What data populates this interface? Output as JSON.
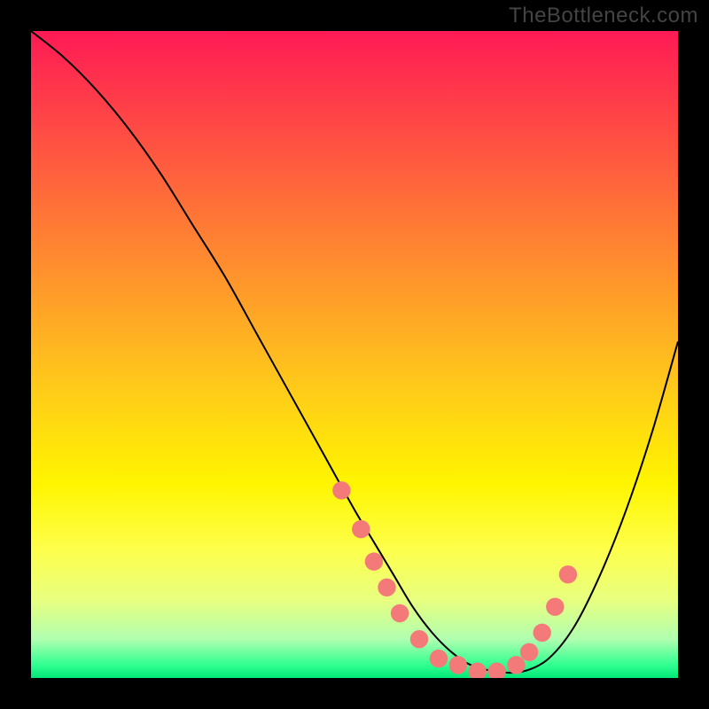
{
  "watermark": "TheBottleneck.com",
  "chart_data": {
    "type": "line",
    "title": "",
    "xlabel": "",
    "ylabel": "",
    "xlim": [
      0,
      100
    ],
    "ylim": [
      0,
      100
    ],
    "series": [
      {
        "name": "curve",
        "x": [
          0,
          5,
          10,
          15,
          20,
          25,
          30,
          35,
          40,
          45,
          50,
          53,
          56,
          59,
          62,
          65,
          68,
          72,
          76,
          80,
          84,
          88,
          92,
          96,
          100
        ],
        "values": [
          100,
          96,
          91,
          85,
          78,
          70,
          62,
          53,
          44,
          35,
          26,
          21,
          16,
          11,
          7,
          4,
          2,
          1,
          1,
          3,
          8,
          16,
          26,
          38,
          52
        ]
      }
    ],
    "markers": {
      "name": "highlight-points",
      "color": "#f47a7a",
      "x": [
        48,
        51,
        53,
        55,
        57,
        60,
        63,
        66,
        69,
        72,
        75,
        77,
        79,
        81,
        83
      ],
      "values": [
        29,
        23,
        18,
        14,
        10,
        6,
        3,
        2,
        1,
        1,
        2,
        4,
        7,
        11,
        16
      ]
    },
    "gradient_stops": [
      {
        "pos": 0,
        "color": "#ff1a55"
      },
      {
        "pos": 25,
        "color": "#ff6a3a"
      },
      {
        "pos": 55,
        "color": "#ffca1a"
      },
      {
        "pos": 80,
        "color": "#fdff4a"
      },
      {
        "pos": 100,
        "color": "#00e878"
      }
    ]
  }
}
